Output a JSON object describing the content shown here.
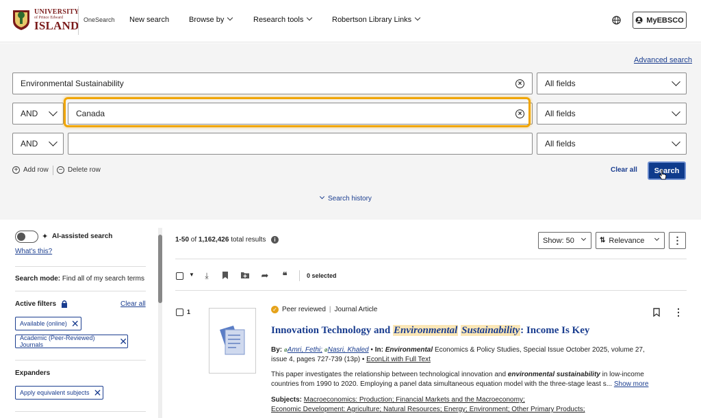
{
  "header": {
    "logo": {
      "line1": "UNIVERSITY",
      "line2": "of Prince Edward",
      "line3": "ISLAND"
    },
    "onesearch": "OneSearch",
    "nav": [
      "New search",
      "Browse by",
      "Research tools",
      "Robertson Library Links"
    ],
    "myebsco": "MyEBSCO"
  },
  "search": {
    "advanced_link": "Advanced search",
    "rows": [
      {
        "operator": "",
        "value": "Environmental Sustainability",
        "field": "All fields"
      },
      {
        "operator": "AND",
        "value": "Canada",
        "field": "All fields"
      },
      {
        "operator": "AND",
        "value": "",
        "field": "All fields"
      }
    ],
    "add_row": "Add row",
    "delete_row": "Delete row",
    "clear_all": "Clear all",
    "search_button": "Search",
    "history": "Search history"
  },
  "sidebar": {
    "ai_label": "AI-assisted search",
    "whats_this": "What's this?",
    "search_mode_label": "Search mode:",
    "search_mode_value": "Find all of my search terms",
    "active_filters": "Active filters",
    "clear_all": "Clear all",
    "filters": [
      "Available (online)",
      "Academic (Peer-Reviewed) Journals"
    ],
    "expanders_title": "Expanders",
    "expanders": [
      "Apply equivalent subjects"
    ]
  },
  "results": {
    "range": "1-50",
    "of": "of",
    "total": "1,162,426",
    "total_label": "total results",
    "show": "Show: 50",
    "sort": "Relevance",
    "selected": "0 selected",
    "item": {
      "number": "1",
      "peer_reviewed": "Peer reviewed",
      "type": "Journal Article",
      "title_pre": "Innovation Technology and ",
      "title_hl1": "Environmental",
      "title_hl2": "Sustainability",
      "title_post": ": Income Is Key",
      "by_label": "By:",
      "author1": "Amri, Fethi;",
      "author2": "Nasri, Khaled",
      "in_label": "In:",
      "journal_bold": "Environmental",
      "journal_rest": "Economics & Policy Studies, Special Issue October 2025, volume 27,",
      "issue": "issue 4, pages 727-739 (13p)",
      "db": "EconLit with Full Text",
      "abstract1_pre": "This paper investigates the relationship between technological innovation and",
      "abstract1_em": "environmental sustainability",
      "abstract1_post": "in low-income",
      "abstract2": "countries from 1990 to 2020. Employing a panel data simultaneous equation model with the three-stage least s...",
      "show_more": "Show more",
      "subjects_label": "Subjects:",
      "subjects1": "Macroeconomics: Production; Financial Markets and the Macroeconomy;",
      "subjects2": "Economic Development: Agriculture; Natural Resources; Energy; Environment; Other Primary Products;"
    }
  },
  "colors": {
    "brand": "#7a1a1a",
    "link": "#1a3d8f",
    "button": "#0f3b8c",
    "highlight": "#f0a500"
  }
}
